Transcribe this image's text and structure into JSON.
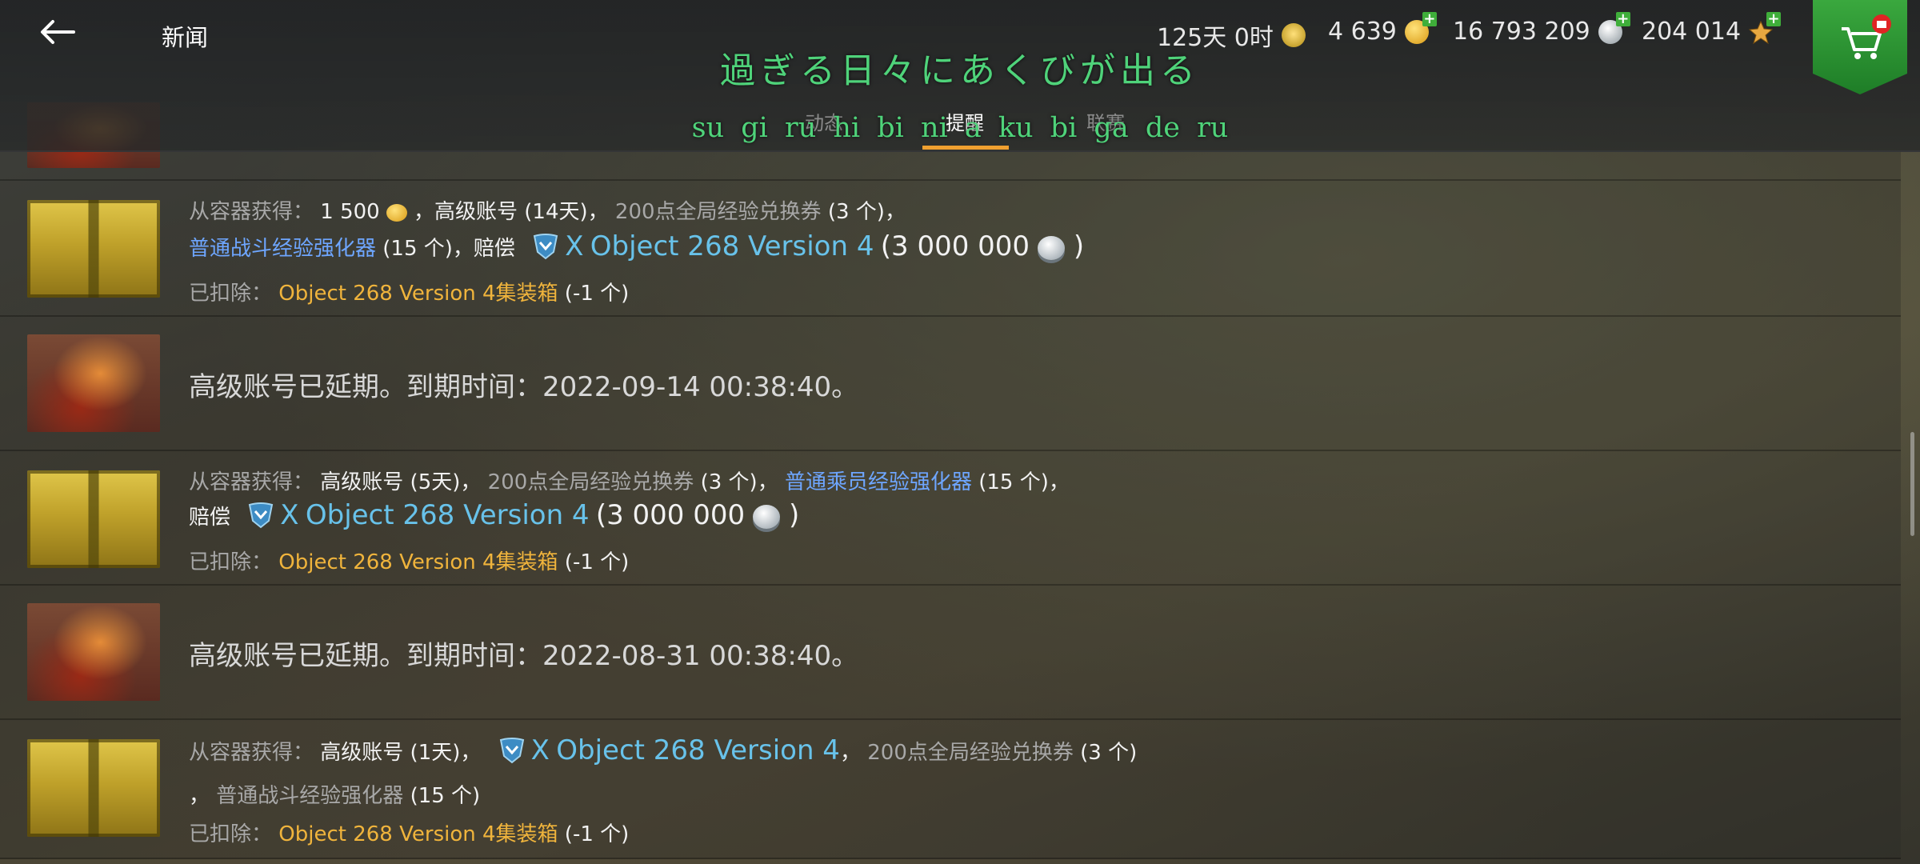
{
  "header": {
    "title": "新闻",
    "lyric_jp": "過ぎる日々にあくびが出る",
    "lyric_romaji": "su gi ru hi bi ni a ku bi ga de ru",
    "stats": {
      "premium_time": "125天 0时",
      "gold": "4 639",
      "credits": "16 793 209",
      "free_xp": "204 014"
    },
    "tabs": [
      {
        "label": "动态"
      },
      {
        "label": "提醒",
        "active": true
      },
      {
        "label": "联赛"
      }
    ]
  },
  "colors": {
    "accent_orange": "#f0a030",
    "lyric_green": "#4fd37a",
    "link_blue": "#6ea6ff",
    "vehicle_blue": "#68c2ea",
    "item_orange": "#f0b43c",
    "shop_green": "#2f9b35"
  },
  "notifications": [
    {
      "type": "container",
      "line1": {
        "prefix": "从容器获得：",
        "amount": "1 500",
        "sep1": "，",
        "premium": "高级账号 (14天)",
        "sep2": "，",
        "voucher": "200点全局经验兑换券",
        "voucher_count": "(3 个)",
        "tail": "，"
      },
      "line2": {
        "booster": "普通战斗经验强化器",
        "booster_count": "(15 个)",
        "comp_prefix": "，赔偿",
        "tier": "X",
        "vehicle": "Object 268 Version 4",
        "comp_amount": "3 000 000",
        "open": "(",
        "close": ")"
      },
      "line3": {
        "prefix": "已扣除：",
        "item": "Object 268 Version 4集装箱",
        "count": "(-1 个)"
      }
    },
    {
      "type": "premium",
      "text": "高级账号已延期。到期时间：2022-09-14 00:38:40。"
    },
    {
      "type": "container",
      "line1": {
        "prefix": "从容器获得：",
        "premium": "高级账号 (5天)",
        "sep1": "，",
        "voucher": "200点全局经验兑换券",
        "voucher_count": "(3 个)",
        "sep2": "，",
        "booster": "普通乘员经验强化器",
        "booster_count": "(15 个)",
        "tail": "，"
      },
      "line2": {
        "comp_prefix": "赔偿",
        "tier": "X",
        "vehicle": "Object 268 Version 4",
        "comp_amount": "3 000 000",
        "open": "(",
        "close": ")"
      },
      "line3": {
        "prefix": "已扣除：",
        "item": "Object 268 Version 4集装箱",
        "count": "(-1 个)"
      }
    },
    {
      "type": "premium",
      "text": "高级账号已延期。到期时间：2022-08-31 00:38:40。"
    },
    {
      "type": "container",
      "line1": {
        "prefix": "从容器获得：",
        "premium": "高级账号 (1天)",
        "sep1": "，",
        "tier": "X",
        "vehicle": "Object 268 Version 4",
        "sep2": "，",
        "voucher": "200点全局经验兑换券",
        "voucher_count": "(3 个)"
      },
      "line2": {
        "lead": "，",
        "booster": "普通战斗经验强化器",
        "booster_count": "(15 个)"
      },
      "line3": {
        "prefix": "已扣除：",
        "item": "Object 268 Version 4集装箱",
        "count": "(-1 个)"
      }
    }
  ]
}
